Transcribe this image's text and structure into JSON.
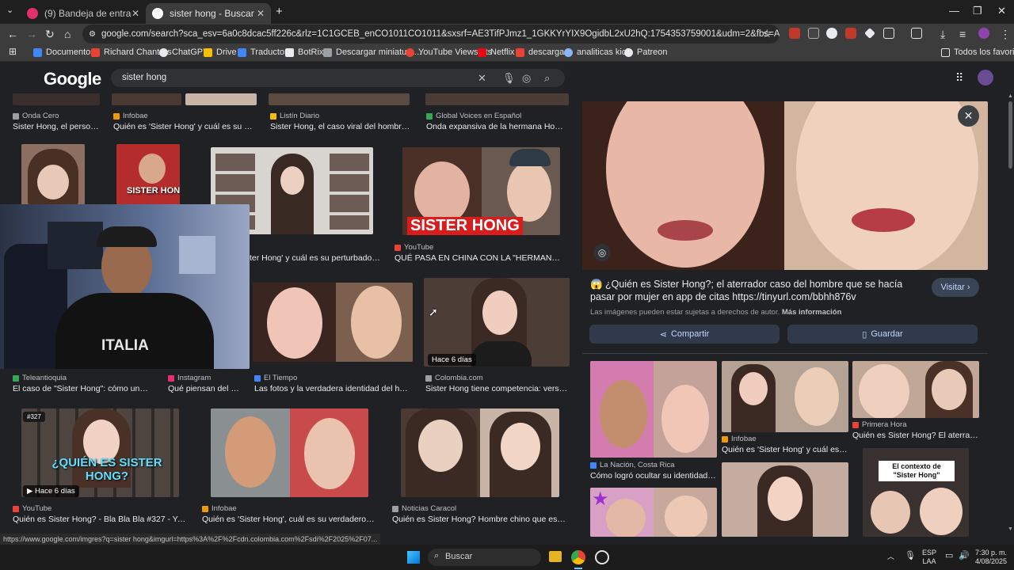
{
  "tabs": [
    {
      "title": "(9) Bandeja de entrada • Chats",
      "active": false
    },
    {
      "title": "sister hong - Buscar con Google",
      "active": true
    }
  ],
  "new_tab_label": "+",
  "window_controls": [
    "—",
    "❐",
    "✕"
  ],
  "address_bar": {
    "url": "google.com/search?sca_esv=6a0c8dcac5ff226c&rlz=1C1GCEB_enCO1011CO1011&sxsrf=AE3TifPJmz1_1GKKYrYIX9OgidbL2xU2hQ:1754353759001&udm=2&fbs=AIIjpHx4nJjfGojPVHhEACUHPiMQht6..."
  },
  "bookmarks": [
    {
      "label": "Documentos",
      "color": "#4285f4"
    },
    {
      "label": "Richard Chantres",
      "color": "#ea4335"
    },
    {
      "label": "ChatGPT",
      "color": "#e8eaed"
    },
    {
      "label": "Drive",
      "color": "#fbbc04"
    },
    {
      "label": "Traductor",
      "color": "#4285f4"
    },
    {
      "label": "BotRix",
      "color": "#e8eaed"
    },
    {
      "label": "Descargar miniatura...",
      "color": "#9aa0a6"
    },
    {
      "label": "YouTube Viewstats",
      "color": "#ea4335"
    },
    {
      "label": "Netflix",
      "color": "#e50914"
    },
    {
      "label": "descargar",
      "color": "#ea4335"
    },
    {
      "label": "analiticas kick",
      "color": "#8ab4f8"
    },
    {
      "label": "Patreon",
      "color": "#e8eaed"
    }
  ],
  "all_bookmarks_label": "Todos los favoritos",
  "google": {
    "logo": "Google",
    "query": "sister hong",
    "clear_label": "✕"
  },
  "results": {
    "row1": [
      {
        "source": "Onda Cero",
        "caption": "Sister Hong, el person...",
        "color": "#9aa0a6"
      },
      {
        "source": "Infobae",
        "caption": "Quién es 'Sister Hong' y cuál es su pert...",
        "color": "#f29900"
      },
      {
        "source": "Listín Diario",
        "caption": "Sister Hong, el caso viral del hombre c...",
        "color": "#fbbc04"
      },
      {
        "source": "Global Voices en Español",
        "caption": "Onda expansiva de la hermana Hong: ...",
        "color": "#34a853"
      }
    ],
    "row2": [
      {
        "source": "YouTube",
        "caption": "QUÉ PASA EN CHINA CON LA \"HERMANA HO...",
        "overlay": "SISTER HONG",
        "color": "#ea4335"
      },
      {
        "caption": "ter Hong' y cuál es su perturbadora ..."
      },
      {
        "overlay": "SISTER HONG"
      }
    ],
    "row3": [
      {
        "source": "Teleantioquia",
        "caption": "El caso de \"Sister Hong\": cómo un ho...",
        "color": "#34a853"
      },
      {
        "source": "Instagram",
        "caption": "Qué piensan del c...",
        "color": "#e1306c"
      },
      {
        "source": "El Tiempo",
        "caption": "Las fotos y la verdadera identidad del homb...",
        "color": "#4285f4"
      },
      {
        "source": "Colombia.com",
        "caption": "Sister Hong tiene competencia: versión...",
        "badge": "Hace 6 días",
        "color": "#9aa0a6"
      }
    ],
    "row4": [
      {
        "source": "YouTube",
        "caption": "Quién es Sister Hong? - Bla Bla Bla #327 - YouT...",
        "overlay": "¿QUIÉN ES SISTER HONG?",
        "badge": "Hace 6 días",
        "tag": "#327",
        "color": "#ea4335"
      },
      {
        "source": "Infobae",
        "caption": "Quién es 'Sister Hong', cuál es su verdadero rost...",
        "color": "#f29900"
      },
      {
        "source": "Noticias Caracol",
        "caption": "Quién es Sister Hong? Hombre chino que estafó ...",
        "color": "#9aa0a6"
      }
    ]
  },
  "webcam_shirt_text": "ITALIA",
  "panel": {
    "title": "😱 ¿Quién es Sister Hong?; el aterrador caso del hombre que se hacía pasar por mujer en app de citas https://tinyurl.com/bbhh876v",
    "visit_label": "Visitar",
    "copyright_note": "Las imágenes pueden estar sujetas a derechos de autor.",
    "more_info_label": "Más información",
    "share_label": "Compartir",
    "save_label": "Guardar",
    "related": [
      {
        "source": "La Nación, Costa Rica",
        "caption": "Cómo logró ocultar su identidad co..."
      },
      {
        "source": "Infobae",
        "caption": "Quién es 'Sister Hong' y cuál es su..."
      },
      {
        "source": "Primera Hora",
        "caption": "Quién es Sister Hong? El aterrador..."
      },
      {
        "overlay": "El contexto de \"Sister Hong\""
      }
    ]
  },
  "status_url": "https://www.google.com/imgres?q=sister hong&imgurl=https%3A%2F%2Fcdn.colombia.com%2Fsdi%2F2025%2F07...",
  "taskbar": {
    "search_placeholder": "Buscar",
    "lang": "ESP",
    "lang2": "LAA",
    "time": "7:30 p. m.",
    "date": "4/08/2025"
  }
}
